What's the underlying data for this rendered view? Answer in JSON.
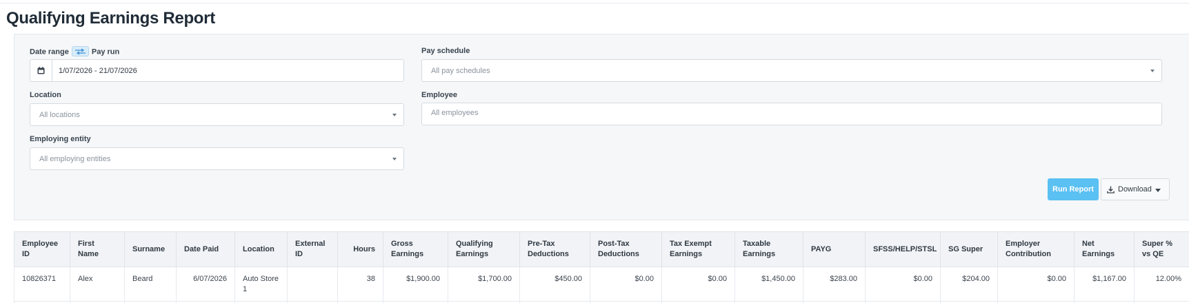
{
  "page": {
    "title": "Qualifying Earnings Report"
  },
  "filters": {
    "date_range": {
      "label": "Date range",
      "alt_label": "Pay run",
      "value": "1/07/2026 - 21/07/2026",
      "icon": "calendar-icon",
      "toggle_icon": "swap-arrows-icon"
    },
    "pay_schedule": {
      "label": "Pay schedule",
      "placeholder": "All pay schedules"
    },
    "location": {
      "label": "Location",
      "placeholder": "All locations"
    },
    "employee": {
      "label": "Employee",
      "placeholder": "All employees"
    },
    "employing_entity": {
      "label": "Employing entity",
      "placeholder": "All employing entities"
    }
  },
  "actions": {
    "run_report": "Run Report",
    "download": "Download",
    "download_icon": "download-icon",
    "run_color": "#5bc0f2"
  },
  "table": {
    "columns": [
      "Employee ID",
      "First Name",
      "Surname",
      "Date Paid",
      "Location",
      "External ID",
      "Hours",
      "Gross Earnings",
      "Qualifying Earnings",
      "Pre-Tax Deductions",
      "Post-Tax Deductions",
      "Tax Exempt Earnings",
      "Taxable Earnings",
      "PAYG",
      "SFSS/HELP/STSL",
      "SG Super",
      "Employer Contribution",
      "Net Earnings",
      "Super % vs QE"
    ],
    "rows": [
      {
        "employee_id": "10826371",
        "first_name": "Alex",
        "surname": "Beard",
        "date_paid": "6/07/2026",
        "location": "Auto Store 1",
        "external_id": "",
        "hours": "38",
        "gross_earnings": "$1,900.00",
        "qualifying_earnings": "$1,700.00",
        "pre_tax_deductions": "$450.00",
        "post_tax_deductions": "$0.00",
        "tax_exempt_earnings": "$0.00",
        "taxable_earnings": "$1,450.00",
        "payg": "$283.00",
        "sfss_help_stsl": "$0.00",
        "sg_super": "$204.00",
        "employer_contribution": "$0.00",
        "net_earnings": "$1,167.00",
        "super_pct_vs_qe": "12.00%"
      }
    ]
  }
}
